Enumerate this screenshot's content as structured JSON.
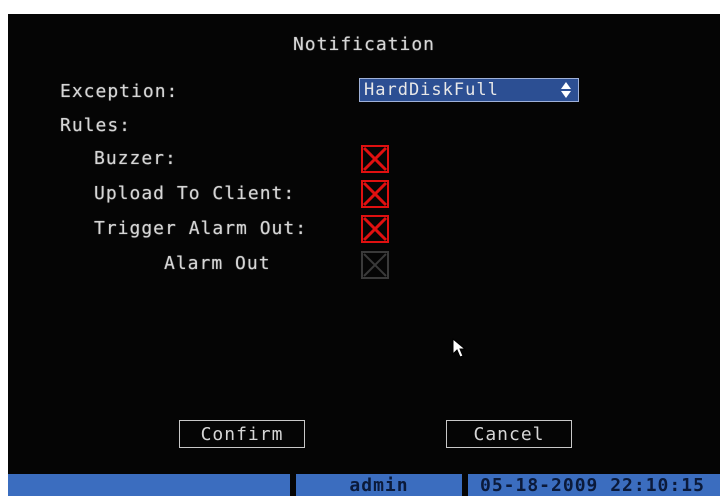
{
  "dialog": {
    "title": "Notification",
    "exception_label": "Exception:",
    "exception_value": "HardDiskFull",
    "rules_label": "Rules:",
    "rules": [
      {
        "label": "Buzzer:",
        "checked": true,
        "enabled": true
      },
      {
        "label": "Upload To Client:",
        "checked": true,
        "enabled": true
      },
      {
        "label": "Trigger Alarm Out:",
        "checked": true,
        "enabled": true
      },
      {
        "label": "Alarm Out",
        "checked": false,
        "enabled": false
      }
    ],
    "confirm_label": "Confirm",
    "cancel_label": "Cancel"
  },
  "statusbar": {
    "user": "admin",
    "datetime": "05-18-2009 22:10:15"
  },
  "colors": {
    "background": "#050505",
    "osd_text": "#d6d6d6",
    "select_bg": "#2c4f93",
    "checkbox_mark": "#e01010",
    "checkbox_disabled": "#3a3a3a",
    "statusbar_bg": "#3b6dbf"
  },
  "icons": {
    "select_arrows": "up-down-arrows-icon",
    "checked": "red-x-icon",
    "pointer": "mouse-pointer-icon"
  }
}
